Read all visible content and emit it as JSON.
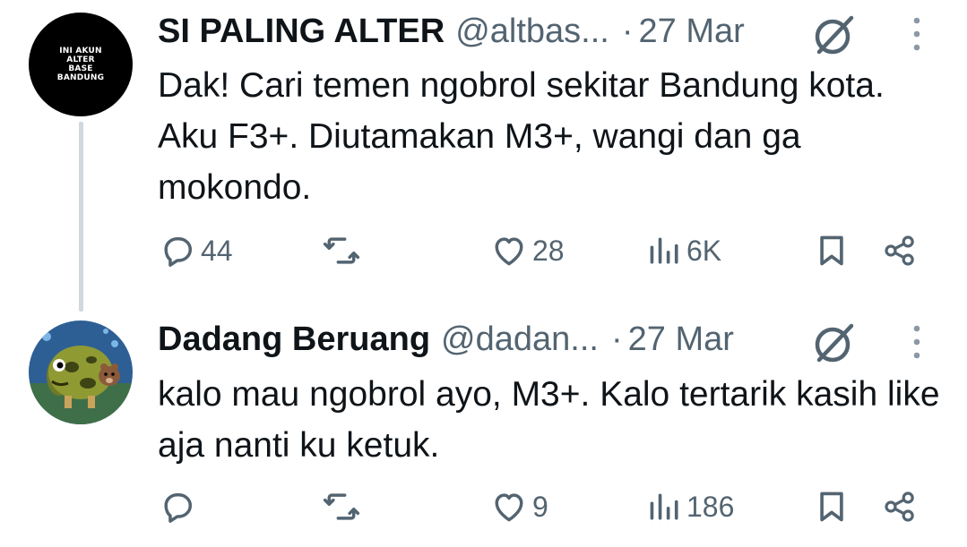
{
  "tweets": [
    {
      "avatar_text": [
        "INI AKUN",
        "ALTER",
        "BASE",
        "BANDUNG"
      ],
      "display_name": "SI PALING ALTER",
      "handle": "@altbas...",
      "separator": "·",
      "date": "27 Mar",
      "text": "Dak! Cari temen ngobrol sekitar Bandung kota. Aku F3+. Diutamakan M3+, wangi dan ga mokondo.",
      "replies": "44",
      "retweets": "",
      "likes": "28",
      "views": "6K"
    },
    {
      "display_name": "Dadang Beruang",
      "handle": "@dadan...",
      "separator": "·",
      "date": "27 Mar",
      "text": "kalo mau ngobrol ayo, M3+. Kalo tertarik kasih like aja nanti ku ketuk.",
      "replies": "",
      "retweets": "",
      "likes": "9",
      "views": "186"
    }
  ],
  "colors": {
    "text_primary": "#0f1419",
    "text_secondary": "#536471",
    "thread_line": "#cfd9de",
    "background": "#ffffff"
  },
  "icons": [
    "reply-icon",
    "retweet-icon",
    "like-icon",
    "views-icon",
    "bookmark-icon",
    "share-icon",
    "grok-icon",
    "more-icon"
  ]
}
